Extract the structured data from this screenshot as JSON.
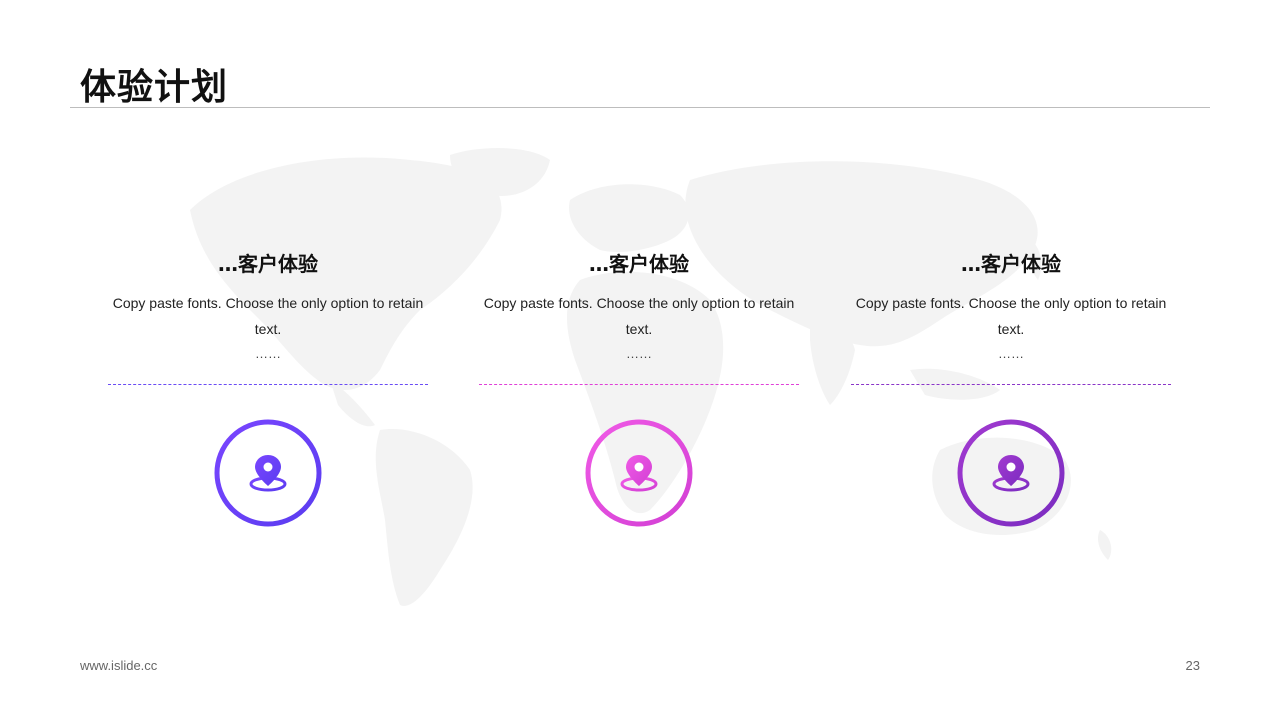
{
  "slide": {
    "title": "体验计划",
    "footer_url": "www.islide.cc",
    "page_number": "23"
  },
  "cards": [
    {
      "heading": "…客户体验",
      "body": "Copy paste fonts. Choose the only option to retain text.",
      "ellipsis": "……",
      "icon": "location-pin-icon",
      "accent_from": "#6a3cf5",
      "accent_to": "#7d52ff",
      "divider_color": "#6a4cf5"
    },
    {
      "heading": "…客户体验",
      "body": "Copy paste fonts. Choose the only option to retain text.",
      "ellipsis": "……",
      "icon": "location-pin-icon",
      "accent_from": "#d84ad6",
      "accent_to": "#f05ae6",
      "divider_color": "#e040d8"
    },
    {
      "heading": "…客户体验",
      "body": "Copy paste fonts. Choose the only option to retain text.",
      "ellipsis": "……",
      "icon": "location-pin-icon",
      "accent_from": "#7a2bc0",
      "accent_to": "#a23ad0",
      "divider_color": "#8a34c8"
    }
  ]
}
